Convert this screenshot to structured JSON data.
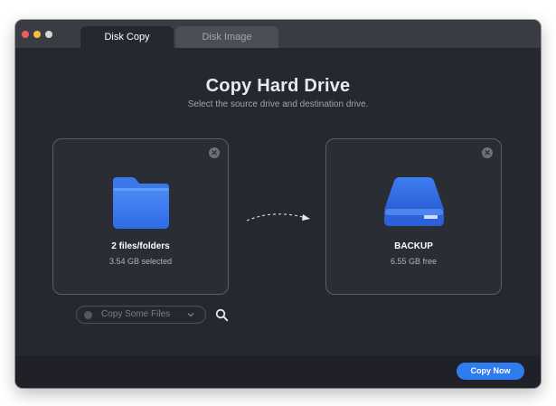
{
  "tabs": [
    {
      "label": "Disk Copy"
    },
    {
      "label": "Disk Image"
    }
  ],
  "main": {
    "title": "Copy Hard Drive",
    "subtitle": "Select the source drive and destination drive."
  },
  "source": {
    "title": "2 files/folders",
    "detail": "3.54 GB selected",
    "icon": "folder-icon"
  },
  "destination": {
    "title": "BACKUP",
    "detail": "6.55 GB free",
    "icon": "hard-drive-icon"
  },
  "copy_select": {
    "value": "Copy Some Files"
  },
  "footer": {
    "copy_now_label": "Copy Now"
  },
  "colors": {
    "accent": "#2f7cf0",
    "window_bg": "#262831",
    "close": "#ec5e56",
    "minimize": "#f2be3f"
  }
}
